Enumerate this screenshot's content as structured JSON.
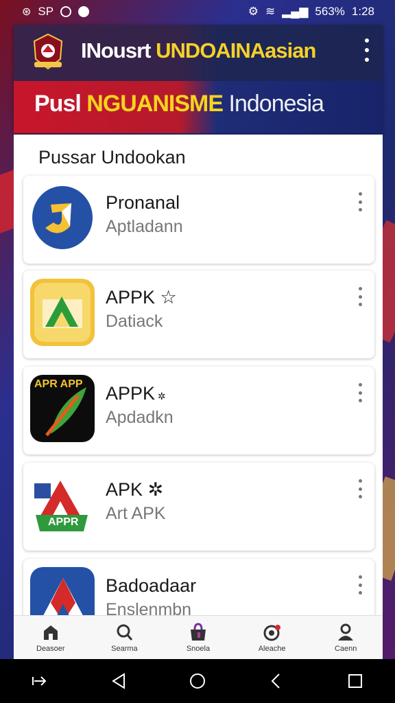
{
  "status_bar": {
    "left_text": "SP",
    "right_text": "563%",
    "time": "1:28"
  },
  "header": {
    "title_white": "INousrt",
    "title_yellow": "UNDOAINAasian",
    "subtitle_white": "Pusl",
    "subtitle_yellow": "NGUANISME",
    "subtitle_normal": "Indonesia"
  },
  "section_title": "Pussar Undookan",
  "apps": [
    {
      "name": "Pronanal",
      "subtitle": "Aptladann",
      "icon": "blue-j-app-icon"
    },
    {
      "name": "APPK",
      "subtitle": "Datiack",
      "icon": "green-arrow-app-icon",
      "icon_text": ""
    },
    {
      "name": "APPK",
      "subtitle": "Apdadkn",
      "icon": "black-leaf-app-icon",
      "icon_text": "APR APP"
    },
    {
      "name": "APK",
      "subtitle": "Art APK",
      "icon": "red-a-app-icon",
      "icon_text": "APPR"
    },
    {
      "name": "Badoadaar",
      "subtitle": "Enslenmbn",
      "icon": "blue-a-app-icon"
    }
  ],
  "bottom_nav": [
    {
      "label": "Deasoer",
      "icon": "home-icon"
    },
    {
      "label": "Searma",
      "icon": "search-icon"
    },
    {
      "label": "Snoela",
      "icon": "store-icon"
    },
    {
      "label": "Aleache",
      "icon": "alert-icon"
    },
    {
      "label": "Caenn",
      "icon": "profile-icon"
    }
  ],
  "colors": {
    "header_red": "#c7162b",
    "header_blue": "#1f2d78",
    "accent_yellow": "#f5d02a"
  }
}
